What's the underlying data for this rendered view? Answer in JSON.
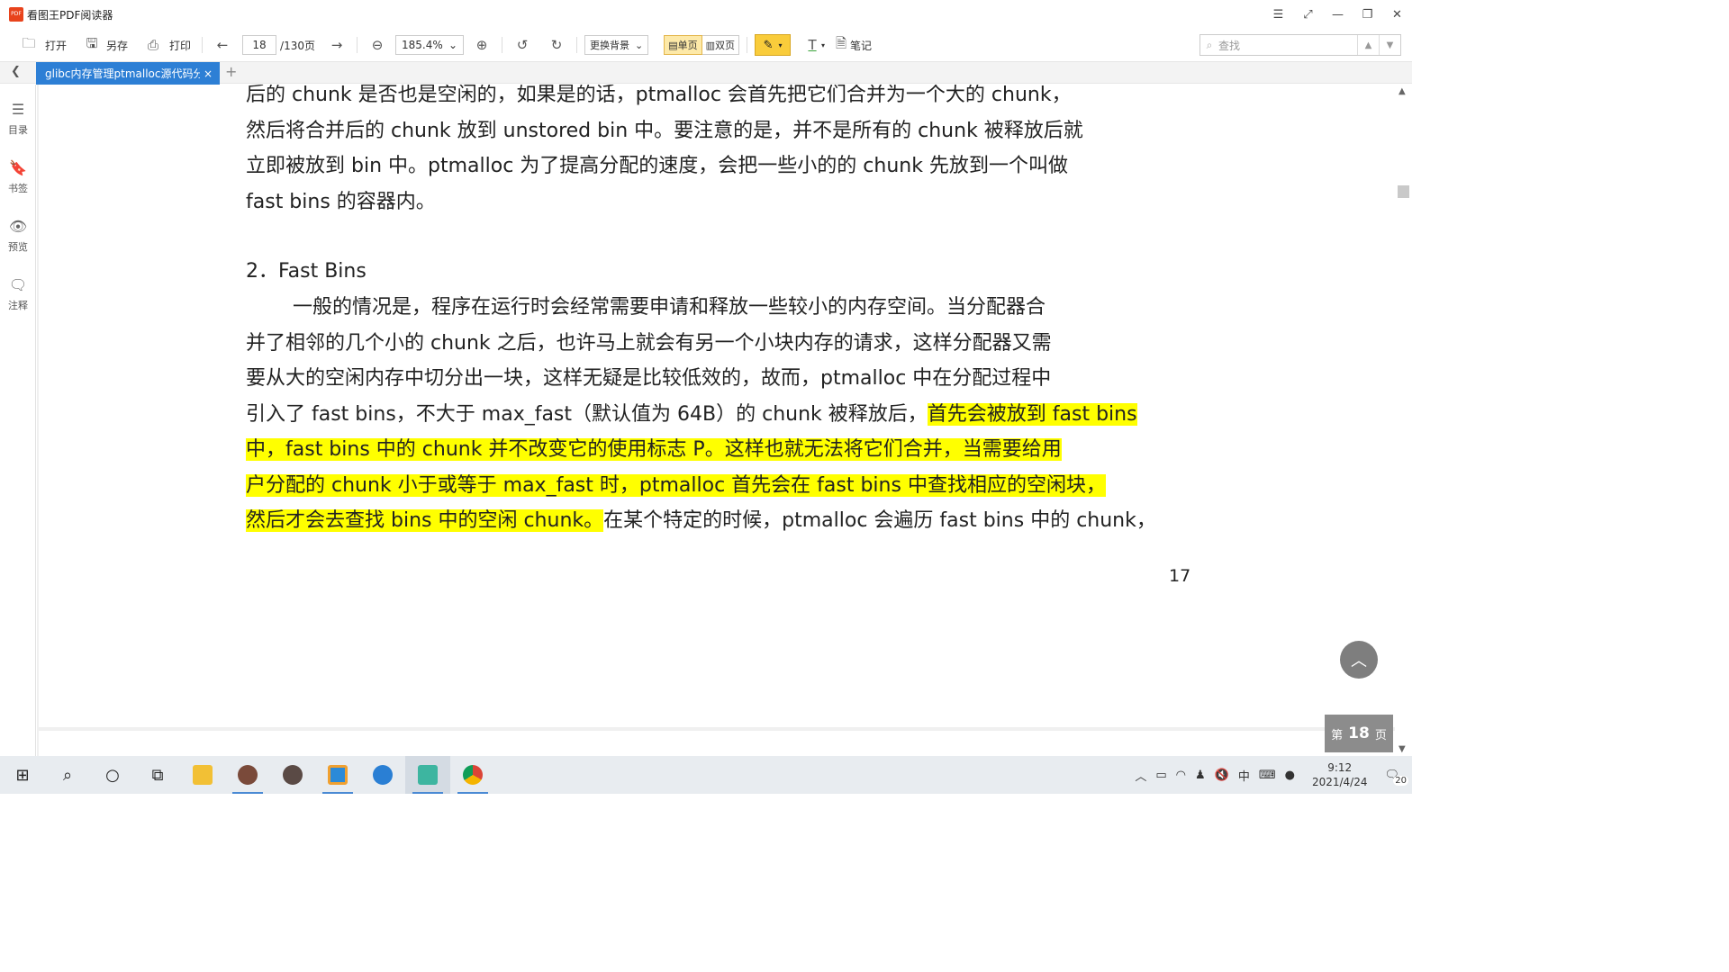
{
  "app": {
    "logo": "PDF",
    "title": "看图王PDF阅读器"
  },
  "window_controls": [
    "menu-icon",
    "fullscreen-icon",
    "minimize-icon",
    "maximize-icon",
    "close-icon"
  ],
  "toolbar": {
    "open_label": "打开",
    "saveas_label": "另存",
    "print_label": "打印",
    "page_value": "18",
    "page_total": "/130页",
    "zoom_value": "185.4%",
    "bg_label": "更换背景",
    "single_label": "单页",
    "double_label": "双页",
    "note_label": "笔记",
    "search_placeholder": "查找"
  },
  "tab": {
    "label": "glibc内存管理ptmalloc源代码分析",
    "close": "×"
  },
  "sidebar": [
    {
      "label": "目录",
      "icon": "list-icon"
    },
    {
      "label": "书签",
      "icon": "bookmark-icon"
    },
    {
      "label": "预览",
      "icon": "eye-icon"
    },
    {
      "label": "注释",
      "icon": "comment-icon"
    }
  ],
  "document": {
    "para1": [
      "后的 chunk 是否也是空闲的，如果是的话，ptmalloc 会首先把它们合并为一个大的 chunk，",
      "然后将合并后的 chunk 放到 unstored bin 中。要注意的是，并不是所有的 chunk 被释放后就",
      "立即被放到 bin 中。ptmalloc 为了提高分配的速度，会把一些小的的 chunk 先放到一个叫做",
      "fast bins 的容器内。"
    ],
    "heading": "2．Fast Bins",
    "para2_l1": "一般的情况是，程序在运行时会经常需要申请和释放一些较小的内存空间。当分配器合",
    "para2_l2": "并了相邻的几个小的 chunk 之后，也许马上就会有另一个小块内存的请求，这样分配器又需",
    "para2_l3": "要从大的空闲内存中切分出一块，这样无疑是比较低效的，故而，ptmalloc 中在分配过程中",
    "para2_l4_plain": "引入了 fast bins，不大于 max_fast（默认值为 64B）的 chunk 被释放后，",
    "para2_l4_hl": "首先会被放到 fast bins",
    "para2_l5_hl": "中，fast bins 中的 chunk 并不改变它的使用标志 P。这样也就无法将它们合并，当需要给用",
    "para2_l6_hl": "户分配的 chunk 小于或等于 max_fast 时，ptmalloc 首先会在 fast bins 中查找相应的空闲块，",
    "para2_l7_hl": "然后才会去查找 bins 中的空闲 chunk。",
    "para2_l7_plain": "在某个特定的时候，ptmalloc 会遍历 fast bins 中的 chunk，",
    "page_number": "17"
  },
  "page_indicator": {
    "prefix": "第",
    "value": "18",
    "suffix": "页"
  },
  "taskbar": {
    "time": "9:12",
    "date": "2021/4/24",
    "notifications": "20",
    "ime": "中"
  },
  "colors": {
    "highlight": "#ffff00",
    "tab_active": "#2d7fd5",
    "pen_active": "#f9cc3b"
  }
}
